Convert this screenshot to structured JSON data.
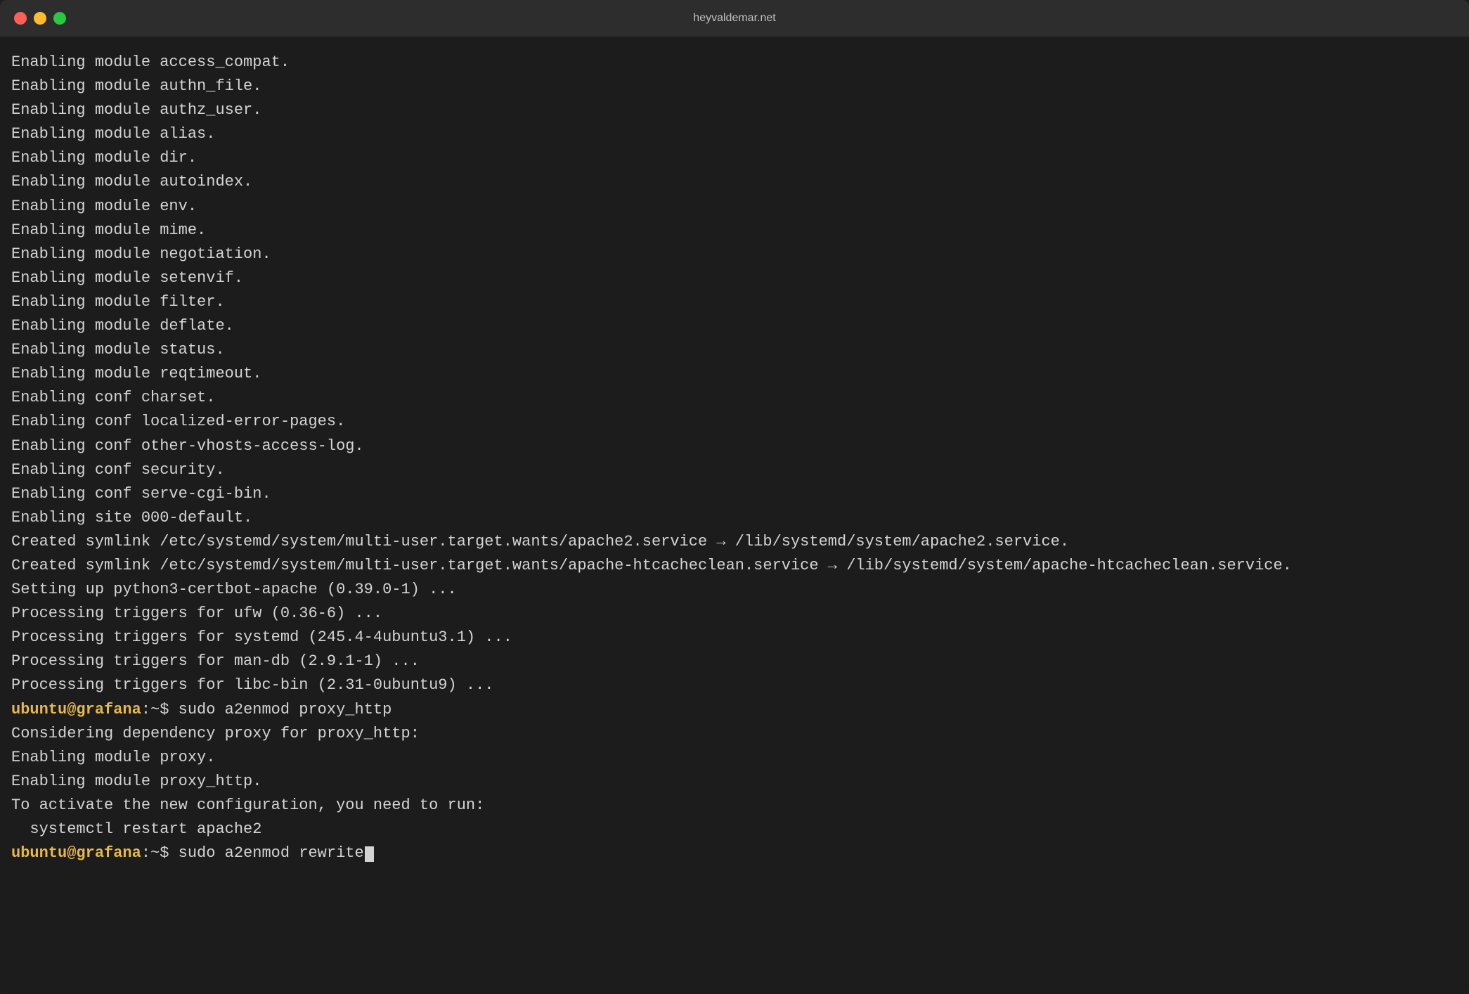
{
  "titlebar": {
    "title": "heyvaldemar.net"
  },
  "terminal": {
    "lines": [
      {
        "type": "output",
        "text": "Enabling module access_compat."
      },
      {
        "type": "output",
        "text": "Enabling module authn_file."
      },
      {
        "type": "output",
        "text": "Enabling module authz_user."
      },
      {
        "type": "output",
        "text": "Enabling module alias."
      },
      {
        "type": "output",
        "text": "Enabling module dir."
      },
      {
        "type": "output",
        "text": "Enabling module autoindex."
      },
      {
        "type": "output",
        "text": "Enabling module env."
      },
      {
        "type": "output",
        "text": "Enabling module mime."
      },
      {
        "type": "output",
        "text": "Enabling module negotiation."
      },
      {
        "type": "output",
        "text": "Enabling module setenvif."
      },
      {
        "type": "output",
        "text": "Enabling module filter."
      },
      {
        "type": "output",
        "text": "Enabling module deflate."
      },
      {
        "type": "output",
        "text": "Enabling module status."
      },
      {
        "type": "output",
        "text": "Enabling module reqtimeout."
      },
      {
        "type": "output",
        "text": "Enabling conf charset."
      },
      {
        "type": "output",
        "text": "Enabling conf localized-error-pages."
      },
      {
        "type": "output",
        "text": "Enabling conf other-vhosts-access-log."
      },
      {
        "type": "output",
        "text": "Enabling conf security."
      },
      {
        "type": "output",
        "text": "Enabling conf serve-cgi-bin."
      },
      {
        "type": "output",
        "text": "Enabling site 000-default."
      },
      {
        "type": "output",
        "text": "Created symlink /etc/systemd/system/multi-user.target.wants/apache2.service → /lib/systemd/system/apache2.service."
      },
      {
        "type": "output",
        "text": "Created symlink /etc/systemd/system/multi-user.target.wants/apache-htcacheclean.service → /lib/systemd/system/apache-htcacheclean.service."
      },
      {
        "type": "output",
        "text": "Setting up python3-certbot-apache (0.39.0-1) ..."
      },
      {
        "type": "output",
        "text": "Processing triggers for ufw (0.36-6) ..."
      },
      {
        "type": "output",
        "text": "Processing triggers for systemd (245.4-4ubuntu3.1) ..."
      },
      {
        "type": "output",
        "text": "Processing triggers for man-db (2.9.1-1) ..."
      },
      {
        "type": "output",
        "text": "Processing triggers for libc-bin (2.31-0ubuntu9) ..."
      },
      {
        "type": "prompt",
        "user": "ubuntu@grafana",
        "path": "~",
        "command": "sudo a2enmod proxy_http"
      },
      {
        "type": "output",
        "text": "Considering dependency proxy for proxy_http:"
      },
      {
        "type": "output",
        "text": "Enabling module proxy."
      },
      {
        "type": "output",
        "text": "Enabling module proxy_http."
      },
      {
        "type": "output",
        "text": "To activate the new configuration, you need to run:"
      },
      {
        "type": "output",
        "text": "  systemctl restart apache2"
      },
      {
        "type": "prompt_cursor",
        "user": "ubuntu@grafana",
        "path": "~",
        "command": "sudo a2enmod rewrite"
      }
    ]
  }
}
